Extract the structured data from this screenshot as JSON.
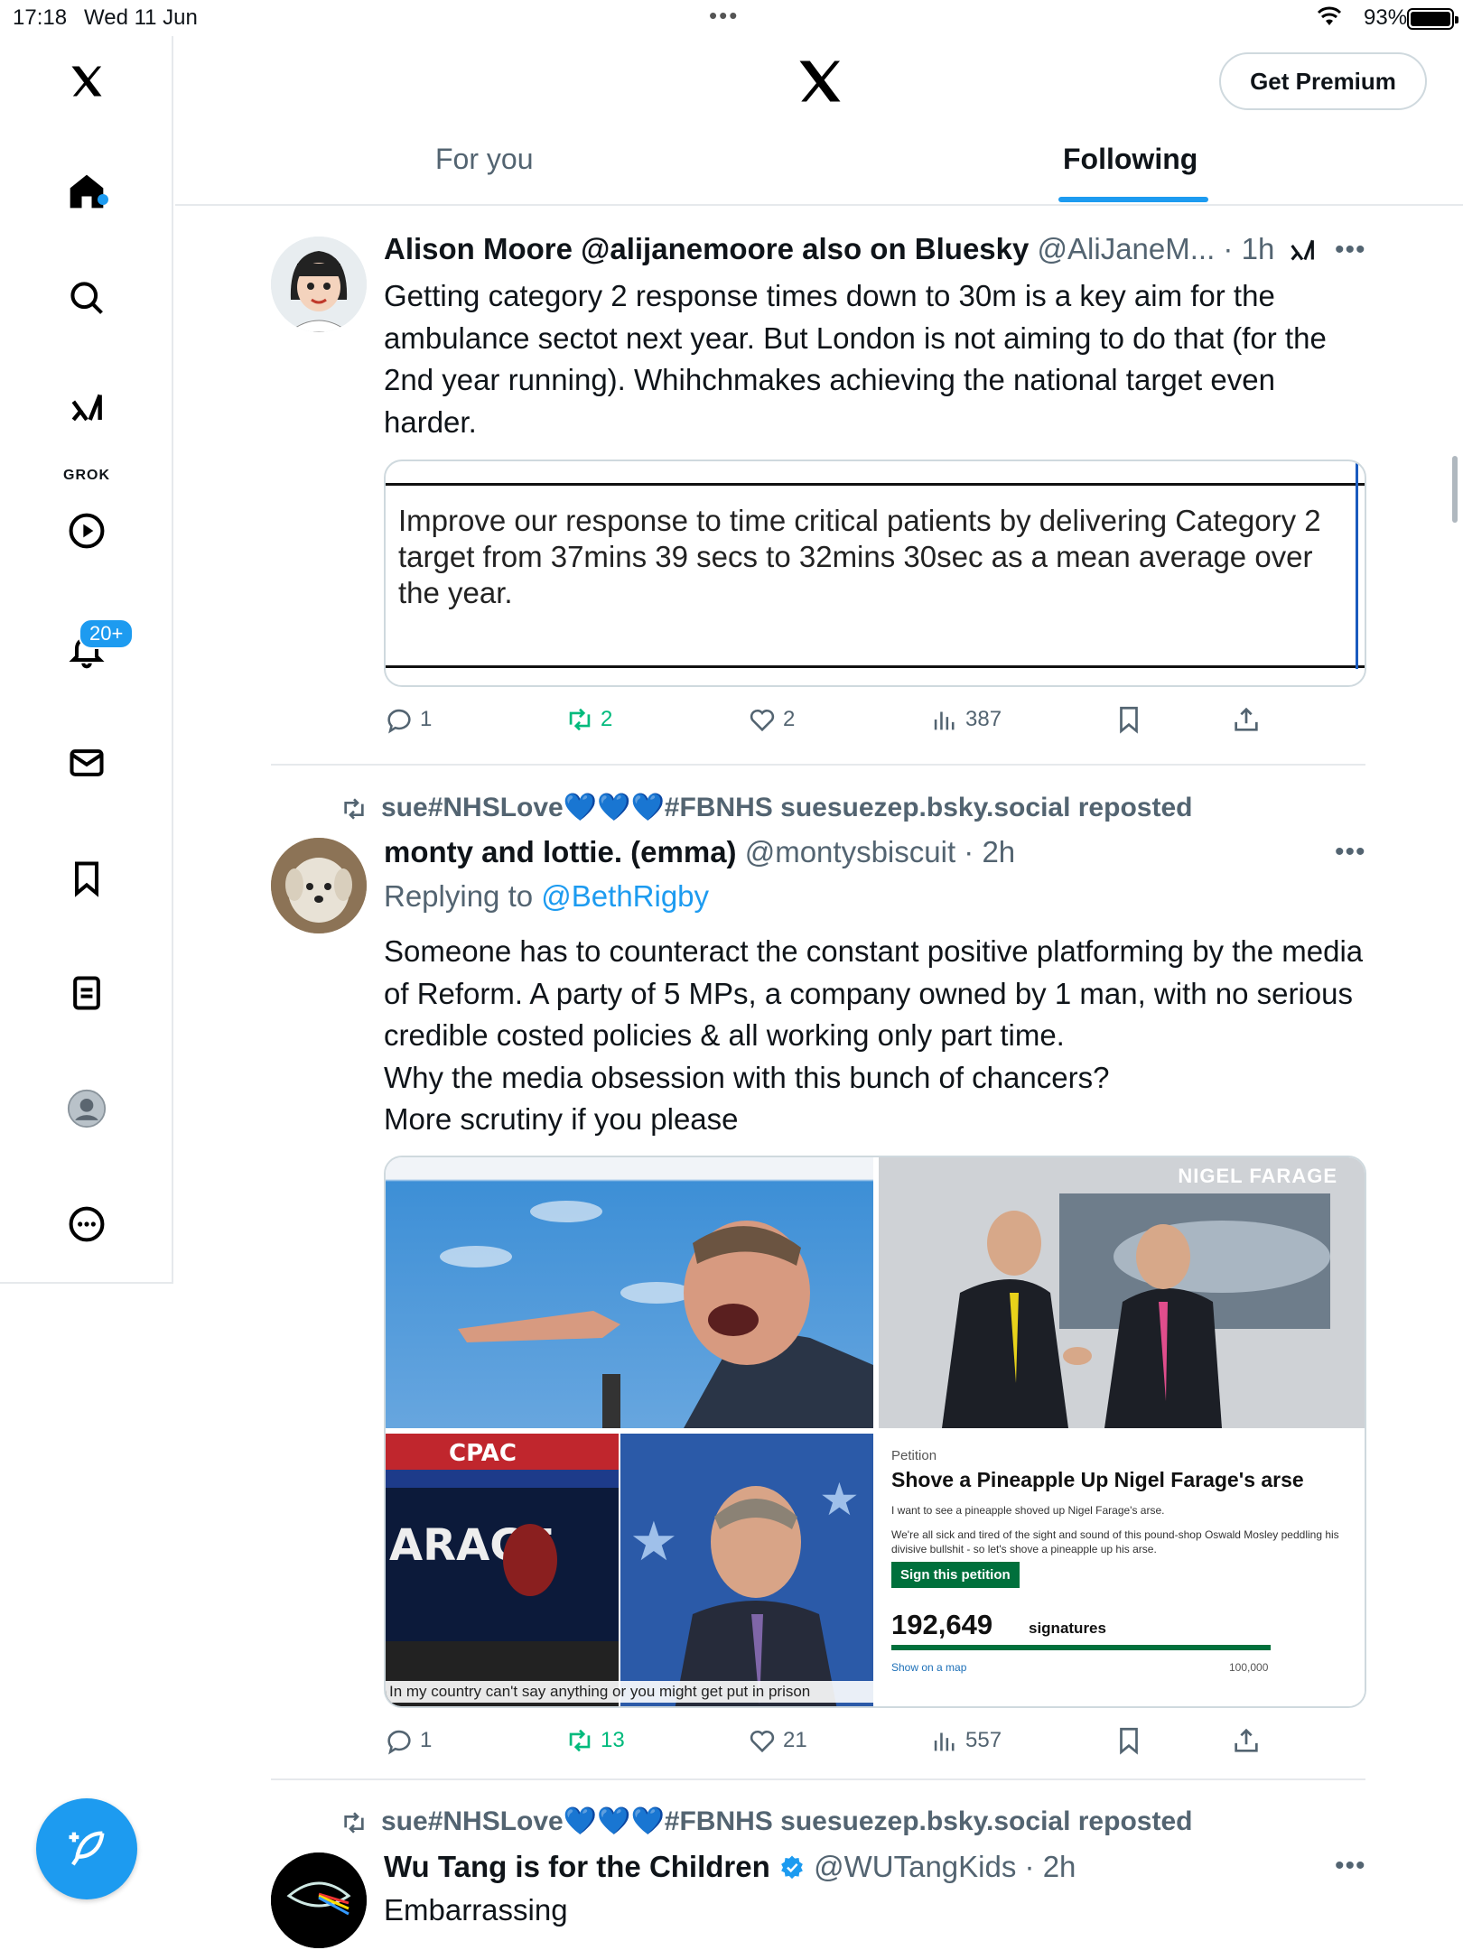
{
  "status_bar": {
    "time": "17:18",
    "date": "Wed 11 Jun",
    "battery": "93%"
  },
  "sidebar": {
    "grok_label": "GROK",
    "notifications_badge": "20+",
    "items": [
      "home",
      "explore",
      "grok",
      "video",
      "notifications",
      "messages",
      "bookmarks",
      "lists",
      "profile",
      "more"
    ]
  },
  "header": {
    "premium_button": "Get Premium",
    "tabs": [
      {
        "label": "For you",
        "active": false
      },
      {
        "label": "Following",
        "active": true
      }
    ]
  },
  "tweets": [
    {
      "name": "Alison Moore @alijanemoore also on Bluesky",
      "handle": "@AliJaneM...",
      "time": "1h",
      "text": "Getting category 2 response times down to 30m is a key aim for the ambulance sectot next year. But London is not aiming to do that (for the 2nd year running). Whihchmakes achieving the national target even harder.",
      "card_text": "Improve our response to time critical patients by delivering Category 2 target from 37mins 39 secs to 32mins 30sec as a mean average over the year.",
      "replies": "1",
      "reposts": "2",
      "likes": "2",
      "views": "387"
    },
    {
      "repost_banner": "sue#NHSLove💙💙💙#FBNHS suesuezep.bsky.social reposted",
      "name": "monty and lottie. (emma)",
      "handle": "@montysbiscuit",
      "time": "2h",
      "replying_label": "Replying to",
      "replying_handle": "@BethRigby",
      "text_lines": [
        "Someone has to counteract the constant positive platforming by the media of Reform. A party of 5 MPs, a company owned by 1 man, with no serious credible costed policies & all working only part time.",
        "Why the media obsession with this bunch of chancers?",
        "More scrutiny if you please"
      ],
      "media": {
        "nigel_label": "NIGEL FARAGE",
        "cpac_caption": "In my country can't say anything or you might get put in prison",
        "petition": {
          "tag": "Petition",
          "title": "Shove a Pineapple Up Nigel Farage's arse",
          "line1": "I want to see a pineapple shoved up Nigel Farage's arse.",
          "line2": "We're all sick and tired of the sight and sound of this pound-shop Oswald Mosley peddling his divisive bullshit - so let's shove a pineapple up his arse.",
          "button": "Sign this petition",
          "count": "192,649",
          "signatures": "signatures",
          "map_link": "Show on a map",
          "goal": "100,000"
        }
      },
      "replies": "1",
      "reposts": "13",
      "likes": "21",
      "views": "557"
    },
    {
      "repost_banner": "sue#NHSLove💙💙💙#FBNHS suesuezep.bsky.social reposted",
      "name": "Wu Tang is for the Children",
      "handle": "@WUTangKids",
      "time": "2h",
      "text": "Embarrassing"
    }
  ],
  "colors": {
    "accent": "#1d9bf0",
    "repost_green": "#00ba7c",
    "secondary_text": "#536471",
    "border": "#e6e9ec"
  }
}
